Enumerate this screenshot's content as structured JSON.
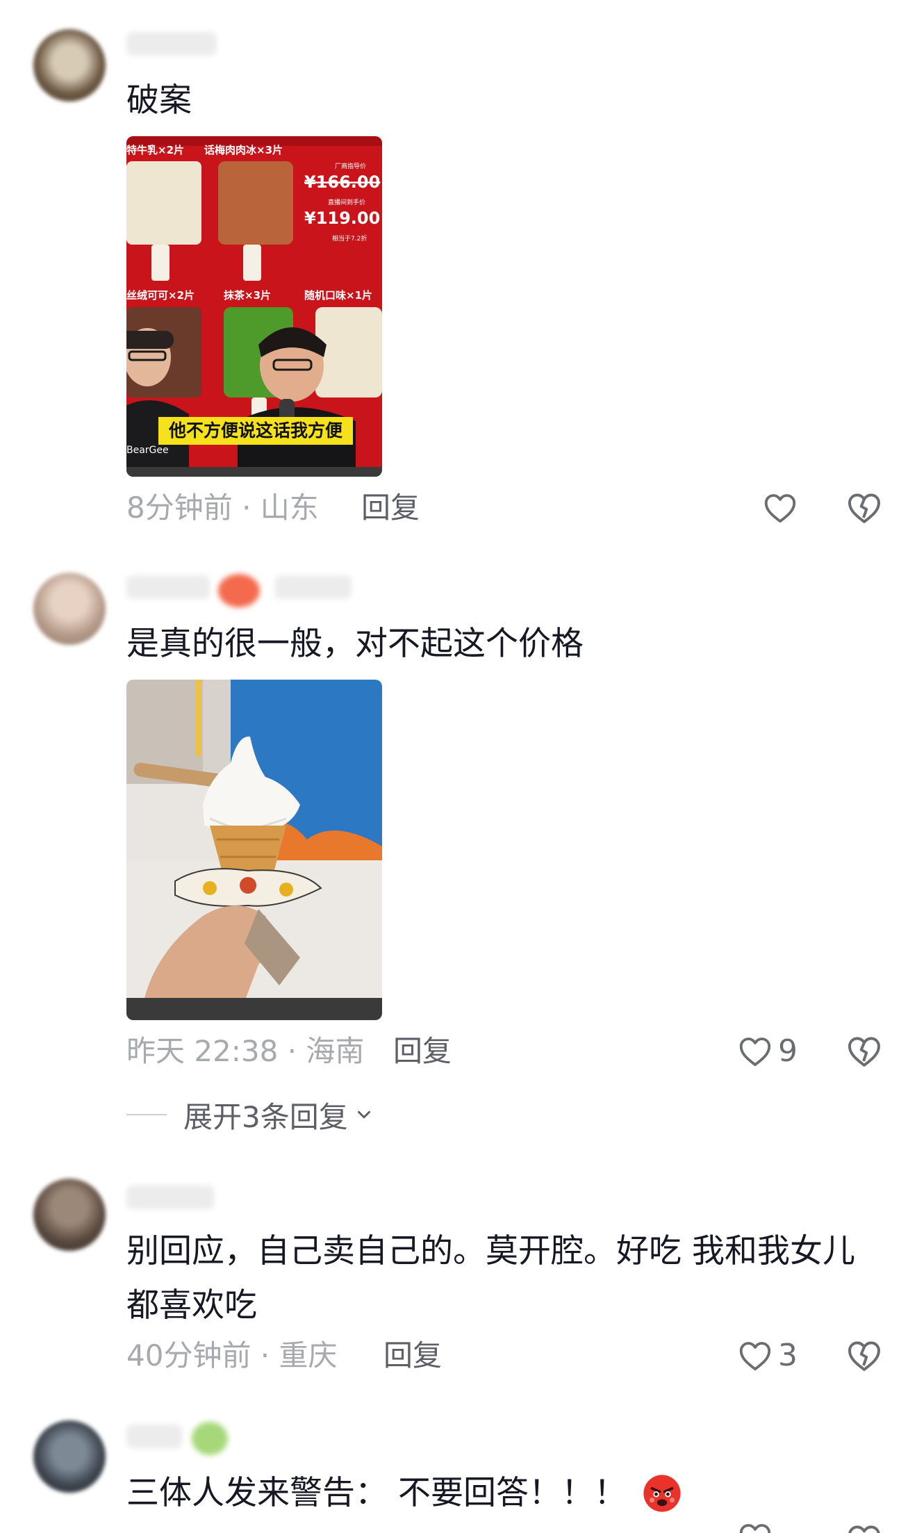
{
  "comments": [
    {
      "text": "破案",
      "image_caption": "他不方便说这话我方便",
      "image_labels": {
        "top_left": "特牛乳×2片",
        "top_mid": "话梅肉肉冰×3片",
        "price_tag": "厂商指导价",
        "price_old": "¥166.00",
        "price_live": "直播间到手价",
        "price_new": "¥119.00",
        "discount": "相当于7.2折",
        "mid_left": "丝绒可可×2片",
        "mid_mid": "抹茶×3片",
        "mid_right": "随机口味×1片",
        "brand": "BearGee"
      },
      "time": "8分钟前 · 山东",
      "reply": "回复",
      "likes": ""
    },
    {
      "text": "是真的很一般，对不起这个价格",
      "time": "昨天 22:38 · 海南",
      "reply": "回复",
      "likes": "9",
      "expand": "展开3条回复"
    },
    {
      "text": "别回应，自己卖自己的。莫开腔。好吃 我和我女儿都喜欢吃",
      "time": "40分钟前 · 重庆",
      "reply": "回复",
      "likes": "3"
    },
    {
      "text": "三体人发来警告： 不要回答！！！",
      "emoji": "angry-face"
    }
  ],
  "colors": {
    "text": "#161823",
    "meta": "#a8a9ae",
    "reply": "#5e5f66",
    "icon": "#6b6c72",
    "red_bg": "#c8141a",
    "caption_bg": "#f6e21c"
  }
}
